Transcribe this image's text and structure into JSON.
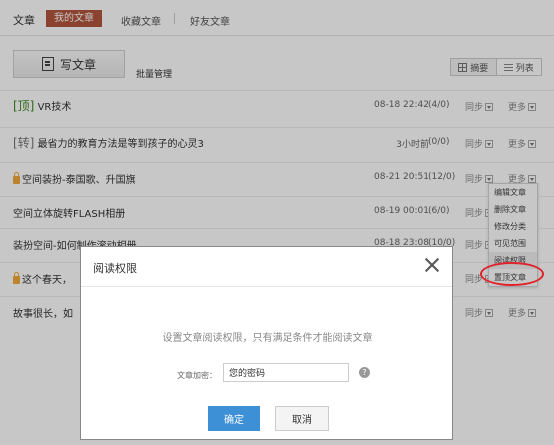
{
  "topnav": {
    "category": "文章",
    "tab_active": "我的文章",
    "tab_favorites": "收藏文章",
    "tab_friends": "好友文章"
  },
  "toolbar": {
    "write_label": "写文章",
    "batch_label": "批量管理",
    "view_summary": "摘要",
    "view_list": "列表"
  },
  "articles": [
    {
      "tag": "[顶]",
      "title": "VR技术",
      "time": "08-18 22:42",
      "count": "(4/0)",
      "sync": "同步",
      "more": "更多"
    },
    {
      "tag": "[转]",
      "title": "最省力的教育方法是等到孩子的心灵3",
      "time": "3小时前",
      "count": "(0/0)",
      "sync": "同步",
      "more": "更多"
    },
    {
      "title": "空间装扮-泰国歌、升国旗",
      "time": "08-21 20:51",
      "count": "(12/0)",
      "sync": "同步",
      "more": "更多"
    },
    {
      "title": "空间立体旋转FLASH相册",
      "time": "08-19 00:01",
      "count": "(6/0)",
      "sync": "同步"
    },
    {
      "title": "装扮空间-如何制作滚动相册",
      "time": "08-18 23:08",
      "count": "(10/0)",
      "sync": "同步"
    },
    {
      "title": "这个春天，",
      "sync": "同步"
    },
    {
      "title": "故事很长，如",
      "sync": "同步",
      "more": "更多"
    }
  ],
  "context_menu": {
    "items": [
      "编辑文章",
      "删除文章",
      "修改分类",
      "可见范围",
      "阅读权限",
      "置顶文章"
    ]
  },
  "dialog": {
    "title": "阅读权限",
    "description": "设置文章阅读权限，只有满足条件才能阅读文章",
    "field_label": "文章加密：",
    "field_value": "您的密码",
    "ok_label": "确定",
    "cancel_label": "取消"
  },
  "colors": {
    "brand": "#b2553b",
    "primary": "#3d8fd6",
    "highlight_ring": "#e0222a",
    "top_tag": "#3a8a1d"
  }
}
